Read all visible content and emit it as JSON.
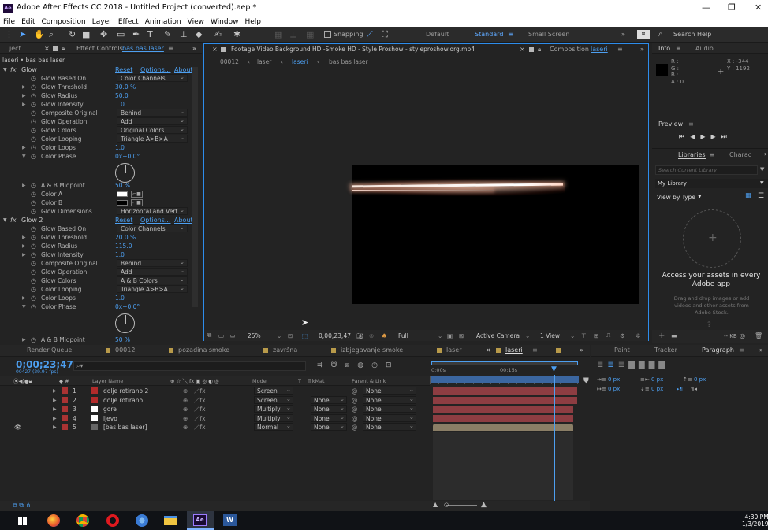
{
  "window": {
    "title": "Adobe After Effects CC 2018 - Untitled Project (converted).aep *",
    "logo": "Ae"
  },
  "menu": [
    "File",
    "Edit",
    "Composition",
    "Layer",
    "Effect",
    "Animation",
    "View",
    "Window",
    "Help"
  ],
  "toolbar": {
    "snapping": "Snapping",
    "workspaces": [
      "Default",
      "Standard",
      "Small Screen"
    ],
    "active_workspace": "Standard",
    "search_placeholder": "Search Help"
  },
  "project_tab": "ject",
  "effect_controls": {
    "tab_prefix": "Effect Controls",
    "tab_layer": "bas bas laser",
    "breadcrumb": "laseri • bas bas laser",
    "fx1": {
      "name": "Glow",
      "reset": "Reset",
      "options": "Options...",
      "about": "About"
    },
    "fx1_rows": [
      {
        "label": "Glow Based On",
        "dd": "Color Channels"
      },
      {
        "label": "Glow Threshold",
        "val": "30.0 %",
        "tri": true
      },
      {
        "label": "Glow Radius",
        "val": "50.0",
        "tri": true
      },
      {
        "label": "Glow Intensity",
        "val": "1.0",
        "tri": true
      },
      {
        "label": "Composite Original",
        "dd": "Behind"
      },
      {
        "label": "Glow Operation",
        "dd": "Add"
      },
      {
        "label": "Glow Colors",
        "dd": "Original Colors"
      },
      {
        "label": "Color Looping",
        "dd": "Triangle A>B>A"
      },
      {
        "label": "Color Loops",
        "val": "1.0",
        "tri": true
      },
      {
        "label": "Color Phase",
        "val": "0x+0.0°",
        "open": true
      }
    ],
    "fx1_rows2": [
      {
        "label": "A & B Midpoint",
        "val": "50 %",
        "tri": true
      },
      {
        "label": "Color A",
        "color": "#ffffff"
      },
      {
        "label": "Color B",
        "color": "#000000"
      },
      {
        "label": "Glow Dimensions",
        "dd": "Horizontal and Vert"
      }
    ],
    "fx2": {
      "name": "Glow 2",
      "reset": "Reset",
      "options": "Options...",
      "about": "About"
    },
    "fx2_rows": [
      {
        "label": "Glow Based On",
        "dd": "Color Channels"
      },
      {
        "label": "Glow Threshold",
        "val": "20.0 %",
        "tri": true
      },
      {
        "label": "Glow Radius",
        "val": "115.0",
        "tri": true
      },
      {
        "label": "Glow Intensity",
        "val": "1.0",
        "tri": true
      },
      {
        "label": "Composite Original",
        "dd": "Behind"
      },
      {
        "label": "Glow Operation",
        "dd": "Add"
      },
      {
        "label": "Glow Colors",
        "dd": "A & B Colors"
      },
      {
        "label": "Color Looping",
        "dd": "Triangle A>B>A"
      },
      {
        "label": "Color Loops",
        "val": "1.0",
        "tri": true
      },
      {
        "label": "Color Phase",
        "val": "0x+0.0°",
        "open": true
      }
    ],
    "fx2_last": {
      "label": "A & B Midpoint",
      "val": "50 %"
    }
  },
  "viewer": {
    "footage_tab": "Footage Video Background HD -Smoke HD - Style Proshow - styleproshow.org.mp4",
    "comp_tab_prefix": "Composition",
    "comp_tab_name": "laseri",
    "crumbs": [
      "00012",
      "laser",
      "laseri",
      "bas bas laser"
    ],
    "zoom": "25%",
    "timecode": "0;00;23;47",
    "resolution": "Full",
    "camera": "Active Camera",
    "views": "1 View"
  },
  "info": {
    "tab": "Info",
    "audio": "Audio",
    "r": "R :",
    "g": "G :",
    "b": "B :",
    "a": "A : 0",
    "x": "X : -344",
    "y": "Y : 1192"
  },
  "preview": {
    "title": "Preview"
  },
  "libraries": {
    "tab": "Libraries",
    "charac": "Charac",
    "search_placeholder": "Search Current Library",
    "library": "My Library",
    "view_by": "View by Type",
    "headline": "Access your assets in every Adobe app",
    "body": "Drag and drop images or add videos and other assets from Adobe Stock.",
    "size": "-- KB"
  },
  "timeline": {
    "tabs": [
      "Render Queue",
      "00012",
      "pozadina smoke",
      "završna",
      "izbjegavanje smoke",
      "laser",
      "laseri"
    ],
    "active_tab": "laseri",
    "timecode": "0;00;23;47",
    "fps": "00427 (29.97 fps)",
    "cols": {
      "layer_name": "Layer Name",
      "mode": "Mode",
      "t": "T",
      "trkmat": "TrkMat",
      "parent": "Parent & Link"
    },
    "ruler": [
      "0:00s",
      "00:15s"
    ],
    "layers": [
      {
        "num": "1",
        "name": "dolje rotirano 2",
        "color": "#b22b2b",
        "mode": "Screen",
        "trk": "",
        "parent": "None"
      },
      {
        "num": "2",
        "name": "dolje rotirano",
        "color": "#b22b2b",
        "mode": "Screen",
        "trk": "None",
        "parent": "None"
      },
      {
        "num": "3",
        "name": "gore",
        "color": "#b22b2b",
        "mode": "Multiply",
        "trk": "None",
        "parent": "None"
      },
      {
        "num": "4",
        "name": "ljevo",
        "color": "#b22b2b",
        "mode": "Multiply",
        "trk": "None",
        "parent": "None"
      },
      {
        "num": "5",
        "name": "[bas bas laser]",
        "color": "#b22b2b",
        "mode": "Normal",
        "trk": "None",
        "parent": "None"
      }
    ]
  },
  "right_bottom": {
    "tabs": [
      "Paint",
      "Tracker",
      "Paragraph"
    ],
    "active": "Paragraph",
    "px": [
      "0 px",
      "0 px",
      "0 px",
      "0 px",
      "0 px"
    ]
  },
  "taskbar": {
    "time": "4:30 PM",
    "date": "1/3/2019"
  },
  "colors": {
    "accent": "#2d8ceb",
    "panel": "#232323",
    "layer_bar": "#8d3d42"
  }
}
